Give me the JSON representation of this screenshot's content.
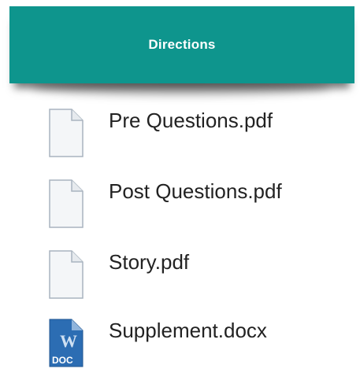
{
  "header": {
    "title": "Directions",
    "color": "#0e958d"
  },
  "files": [
    {
      "name": "Pre Questions.pdf",
      "icon": "document-icon"
    },
    {
      "name": "Post Questions.pdf",
      "icon": "document-icon"
    },
    {
      "name": "Story.pdf",
      "icon": "document-icon"
    },
    {
      "name": "Supplement.docx",
      "icon": "word-doc-icon",
      "icon_label": "DOC",
      "icon_letter": "W"
    }
  ]
}
